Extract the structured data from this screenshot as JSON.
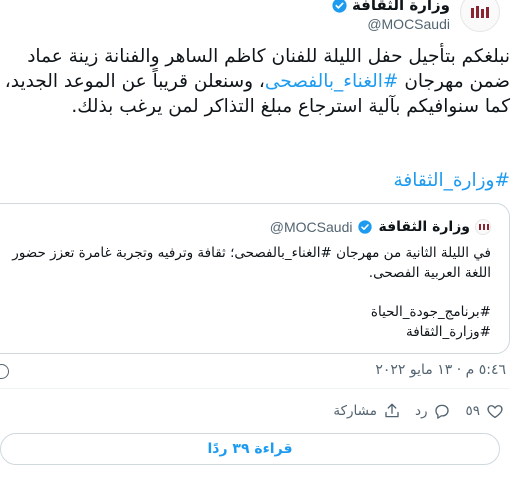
{
  "author": {
    "name": "وزارة الثقافة",
    "handle": "@MOCSaudi"
  },
  "tweet": {
    "text_part1": "نبلغكم بتأجيل حفل الليلة للفنان كاظم الساهر والفنانة زينة عماد ضمن مهرجان ",
    "hashtag_inline": "#الغناء_بالفصحى",
    "text_part2": "، وسنعلن قريباً عن الموعد الجديد، كما سنوافيكم بآلية استرجاع مبلغ التذاكر لمن يرغب بذلك.",
    "hashtag_footer": "#وزارة_الثقافة"
  },
  "quoted_tweet": {
    "name": "وزارة الثقافة",
    "handle": "@MOCSaudi",
    "text": "في الليلة الثانية من مهرجان #الغناء_بالفصحى؛ ثقافة وترفيه وتجربة غامرة تعزز حضور اللغة العربية الفصحى.",
    "tags": [
      "#برنامج_جودة_الحياة",
      "#وزارة_الثقافة"
    ]
  },
  "meta": {
    "timestamp": "٥:٤٦ م · ١٣ مايو ٢٠٢٢"
  },
  "actions": {
    "likes_count": "٥٩",
    "reply_label": "رد",
    "share_label": "مشاركة"
  },
  "replies_button": {
    "label": "قراءة ٣٩ ردًا"
  },
  "colors": {
    "accent": "#1d9bf0",
    "text": "#0f1419",
    "muted": "#536471",
    "border": "#cfd9de"
  }
}
